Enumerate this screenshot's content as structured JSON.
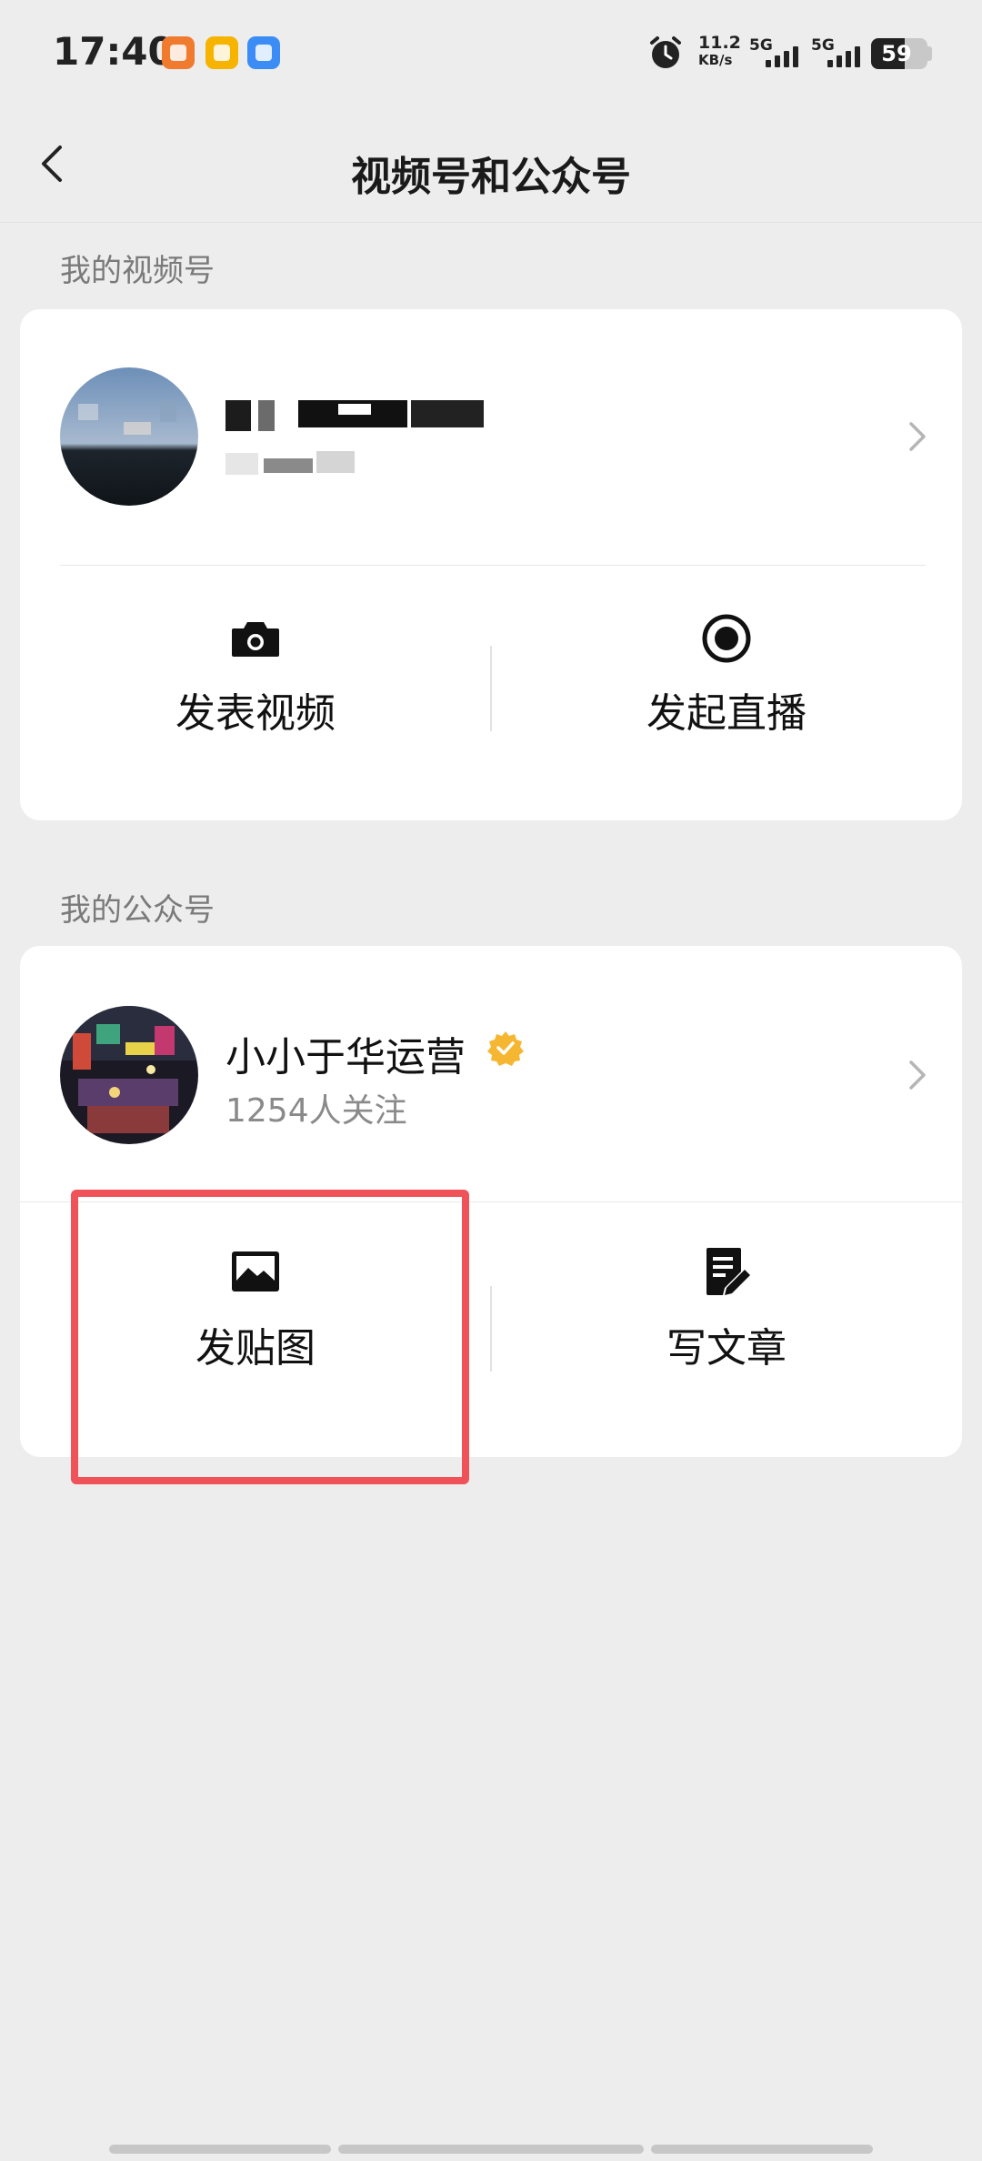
{
  "status_bar": {
    "time": "17:40",
    "app_icons": [
      "orange-app-icon",
      "yellow-app-icon",
      "blue-app-icon"
    ],
    "net_speed_value": "11.2",
    "net_speed_unit": "KB/s",
    "signal1_label": "5G",
    "signal2_label": "5G",
    "battery": "59",
    "battery_level": 0.59
  },
  "nav": {
    "title": "视频号和公众号"
  },
  "channels": {
    "section_title": "我的视频号",
    "actions": [
      {
        "label": "发表视频",
        "icon": "camera-icon"
      },
      {
        "label": "发起直播",
        "icon": "live-record-icon"
      }
    ]
  },
  "official": {
    "section_title": "我的公众号",
    "name": "小小于华运营",
    "followers": "1254人关注",
    "actions": [
      {
        "label": "发贴图",
        "icon": "image-icon"
      },
      {
        "label": "写文章",
        "icon": "edit-document-icon"
      }
    ]
  },
  "colors": {
    "background": "#ededed",
    "card": "#ffffff",
    "verified_badge": "#f5b731",
    "highlight_box": "#f0525a"
  }
}
